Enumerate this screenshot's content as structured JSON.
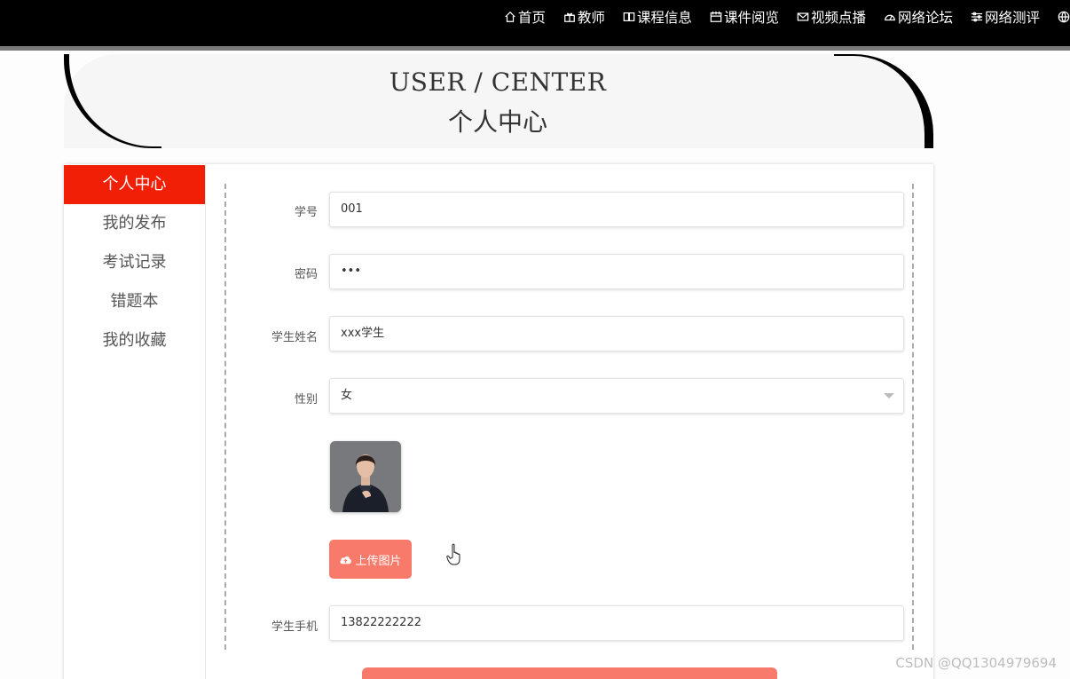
{
  "nav": {
    "items": [
      {
        "label": "首页",
        "icon": "home-icon"
      },
      {
        "label": "教师",
        "icon": "gift-icon"
      },
      {
        "label": "课程信息",
        "icon": "book-open-icon"
      },
      {
        "label": "课件阅览",
        "icon": "calendar-icon"
      },
      {
        "label": "视频点播",
        "icon": "mail-icon"
      },
      {
        "label": "网络论坛",
        "icon": "dashboard-icon"
      },
      {
        "label": "网络测评",
        "icon": "sliders-icon"
      },
      {
        "label": "",
        "icon": "globe-icon"
      }
    ]
  },
  "banner": {
    "title_en": "USER / CENTER",
    "title_cn": "个人中心"
  },
  "sidebar": {
    "items": [
      {
        "label": "个人中心",
        "active": true
      },
      {
        "label": "我的发布",
        "active": false
      },
      {
        "label": "考试记录",
        "active": false
      },
      {
        "label": "错题本",
        "active": false
      },
      {
        "label": "我的收藏",
        "active": false
      }
    ]
  },
  "form": {
    "student_id": {
      "label": "学号",
      "value": "001"
    },
    "password": {
      "label": "密码",
      "value": "•••"
    },
    "student_name": {
      "label": "学生姓名",
      "value": "xxx学生"
    },
    "gender": {
      "label": "性别",
      "value": "女"
    },
    "upload_label": "上传图片",
    "phone": {
      "label": "学生手机",
      "value": "13822222222"
    }
  },
  "watermark": "CSDN @QQ1304979694",
  "colors": {
    "accent_red": "#f01f06",
    "button_salmon": "#f87a6a",
    "topbar": "#000000"
  }
}
